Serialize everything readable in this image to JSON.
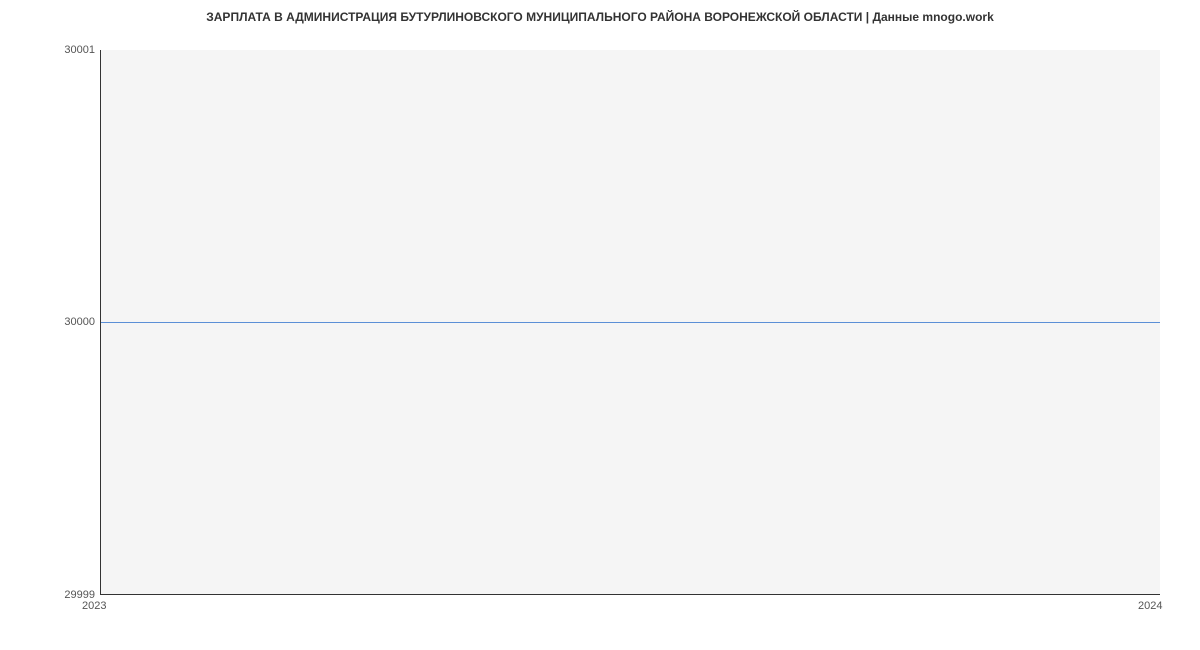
{
  "chart_data": {
    "type": "line",
    "title": "ЗАРПЛАТА В АДМИНИСТРАЦИЯ БУТУРЛИНОВСКОГО МУНИЦИПАЛЬНОГО РАЙОНА ВОРОНЕЖСКОЙ ОБЛАСТИ | Данные mnogo.work",
    "x": [
      2023,
      2024
    ],
    "values": [
      30000,
      30000
    ],
    "xlabel": "",
    "ylabel": "",
    "y_ticks": [
      "29999",
      "30000",
      "30001"
    ],
    "x_ticks": [
      "2023",
      "2024"
    ],
    "ylim": [
      29999,
      30001
    ],
    "xlim": [
      2023,
      2024
    ],
    "line_color": "#5b8fd6",
    "grid": false
  }
}
